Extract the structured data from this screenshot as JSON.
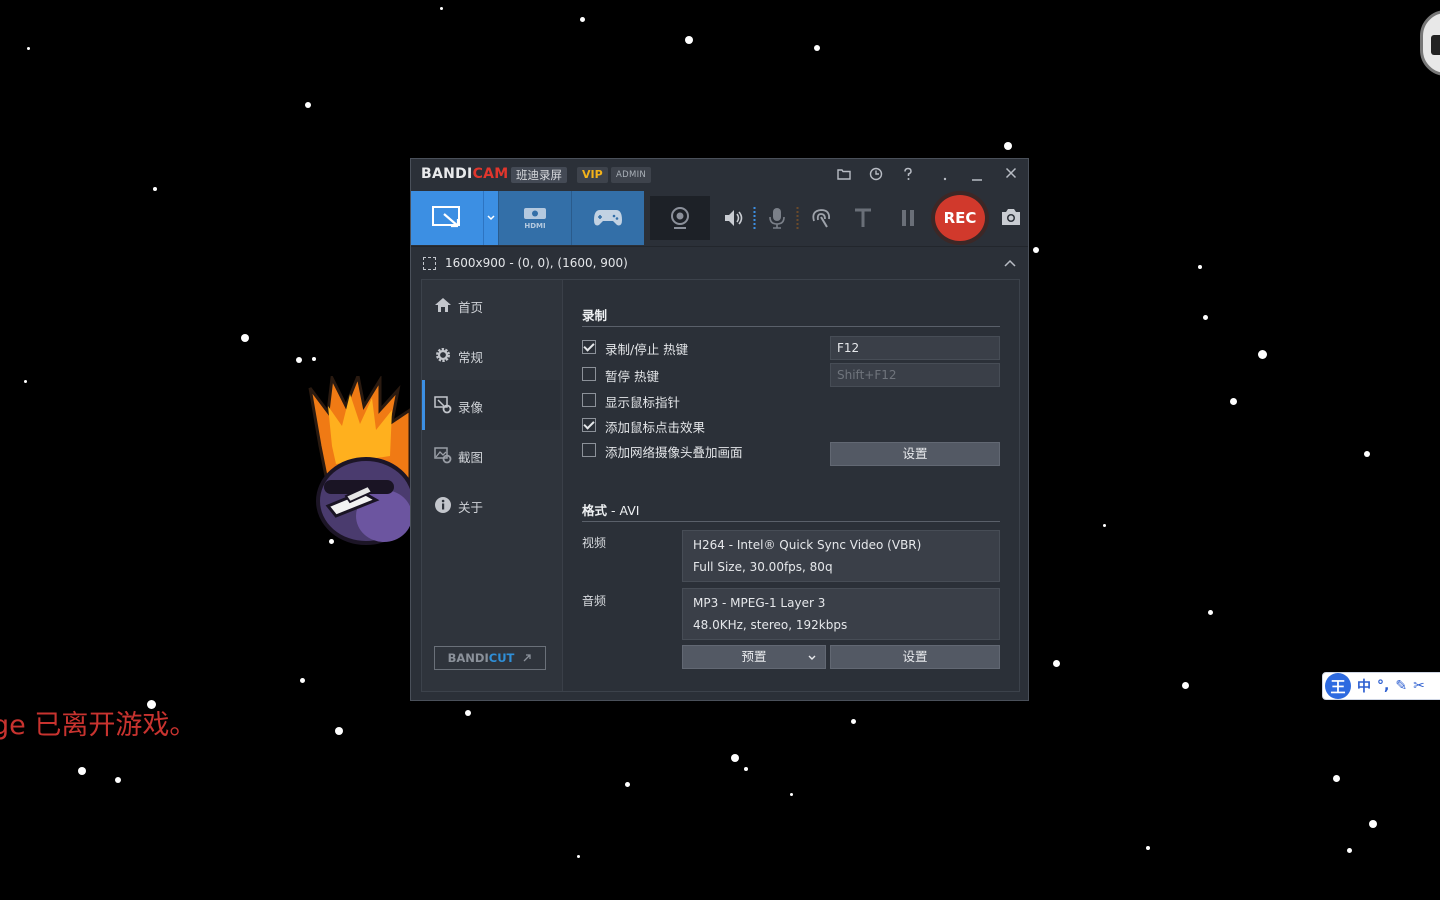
{
  "background": {
    "game_message": "ge 已离开游戏。",
    "ime": {
      "logo": "王",
      "mode": "中",
      "punct": "°,",
      "pen": "✎",
      "tools": "✂"
    }
  },
  "window": {
    "brand_main": "BANDI",
    "brand_accent": "CAM",
    "brand_cn": "班迪录屏",
    "vip": "VIP",
    "admin": "ADMIN",
    "rec_label": "REC",
    "accent_color": "#3c8fe3",
    "rec_color": "#d1392c"
  },
  "area": {
    "text": "1600x900 - (0, 0), (1600, 900)"
  },
  "sidebar": {
    "items": [
      {
        "label": "首页",
        "icon": "home-icon"
      },
      {
        "label": "常规",
        "icon": "gear-icon"
      },
      {
        "label": "录像",
        "icon": "video-settings-icon"
      },
      {
        "label": "截图",
        "icon": "image-settings-icon"
      },
      {
        "label": "关于",
        "icon": "info-icon"
      }
    ],
    "bandicut": {
      "main": "BANDI",
      "accent": "CUT"
    }
  },
  "recording": {
    "title": "录制",
    "options": [
      {
        "label": "录制/停止 热键",
        "checked": true
      },
      {
        "label": "暂停 热键",
        "checked": false
      },
      {
        "label": "显示鼠标指针",
        "checked": false
      },
      {
        "label": "添加鼠标点击效果",
        "checked": true
      },
      {
        "label": "添加网络摄像头叠加画面",
        "checked": false
      }
    ],
    "hotkey_record": "F12",
    "hotkey_pause": "Shift+F12",
    "settings_button": "设置"
  },
  "format": {
    "title_main": "格式",
    "title_value": " - AVI",
    "video_label": "视频",
    "video_line1": "H264 - Intel® Quick Sync Video (VBR)",
    "video_line2": "Full Size, 30.00fps, 80q",
    "audio_label": "音频",
    "audio_line1": "MP3 - MPEG-1 Layer 3",
    "audio_line2": "48.0KHz, stereo, 192kbps",
    "preset_button": "预置",
    "settings_button": "设置"
  }
}
